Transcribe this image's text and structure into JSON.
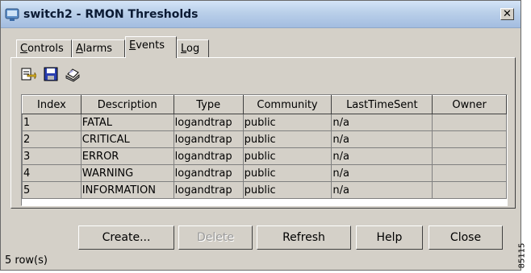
{
  "window": {
    "title": "switch2 - RMON Thresholds",
    "close_label": "✕"
  },
  "tabs": [
    {
      "pre": "",
      "key": "C",
      "post": "ontrols"
    },
    {
      "pre": "",
      "key": "A",
      "post": "larms"
    },
    {
      "pre": "",
      "key": "E",
      "post": "vents"
    },
    {
      "pre": "",
      "key": "L",
      "post": "og"
    }
  ],
  "toolbar": {
    "icons": [
      "apply-icon",
      "save-icon",
      "print-icon"
    ]
  },
  "table": {
    "columns": [
      "Index",
      "Description",
      "Type",
      "Community",
      "LastTimeSent",
      "Owner"
    ],
    "rows": [
      [
        "1",
        "FATAL",
        "logandtrap",
        "public",
        "n/a",
        ""
      ],
      [
        "2",
        "CRITICAL",
        "logandtrap",
        "public",
        "n/a",
        ""
      ],
      [
        "3",
        "ERROR",
        "logandtrap",
        "public",
        "n/a",
        ""
      ],
      [
        "4",
        "WARNING",
        "logandtrap",
        "public",
        "n/a",
        ""
      ],
      [
        "5",
        "INFORMATION",
        "logandtrap",
        "public",
        "n/a",
        ""
      ]
    ]
  },
  "buttons": {
    "create": "Create...",
    "delete": "Delete",
    "refresh": "Refresh",
    "help": "Help",
    "close": "Close"
  },
  "status": {
    "row_count": "5 row(s)"
  },
  "figure_code": "85115"
}
